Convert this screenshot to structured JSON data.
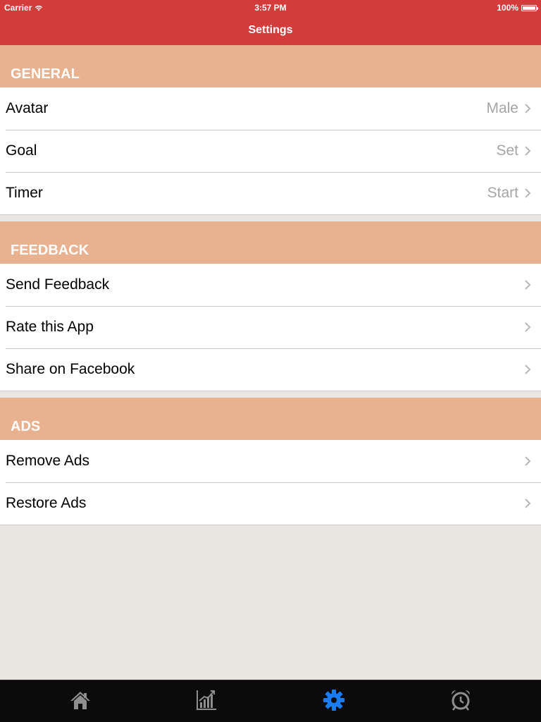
{
  "status_bar": {
    "carrier": "Carrier",
    "time": "3:57 PM",
    "battery": "100%"
  },
  "nav": {
    "title": "Settings"
  },
  "sections": [
    {
      "title": "GENERAL",
      "rows": [
        {
          "label": "Avatar",
          "detail": "Male"
        },
        {
          "label": "Goal",
          "detail": "Set"
        },
        {
          "label": "Timer",
          "detail": "Start"
        }
      ]
    },
    {
      "title": "FEEDBACK",
      "rows": [
        {
          "label": "Send Feedback"
        },
        {
          "label": "Rate this App"
        },
        {
          "label": "Share on Facebook"
        }
      ]
    },
    {
      "title": "ADS",
      "rows": [
        {
          "label": "Remove Ads"
        },
        {
          "label": "Restore Ads"
        }
      ]
    }
  ],
  "tab_bar": {
    "tabs": [
      {
        "icon": "home-icon",
        "selected": false
      },
      {
        "icon": "chart-icon",
        "selected": false
      },
      {
        "icon": "gear-icon",
        "selected": true
      },
      {
        "icon": "alarm-clock-icon",
        "selected": false
      }
    ]
  },
  "colors": {
    "nav_bar": "#d43c3c",
    "section_header": "#e8b18f",
    "background": "#eae6e2",
    "tab_selected": "#1a7cf5",
    "tab_unselected": "#8e8e8e"
  }
}
